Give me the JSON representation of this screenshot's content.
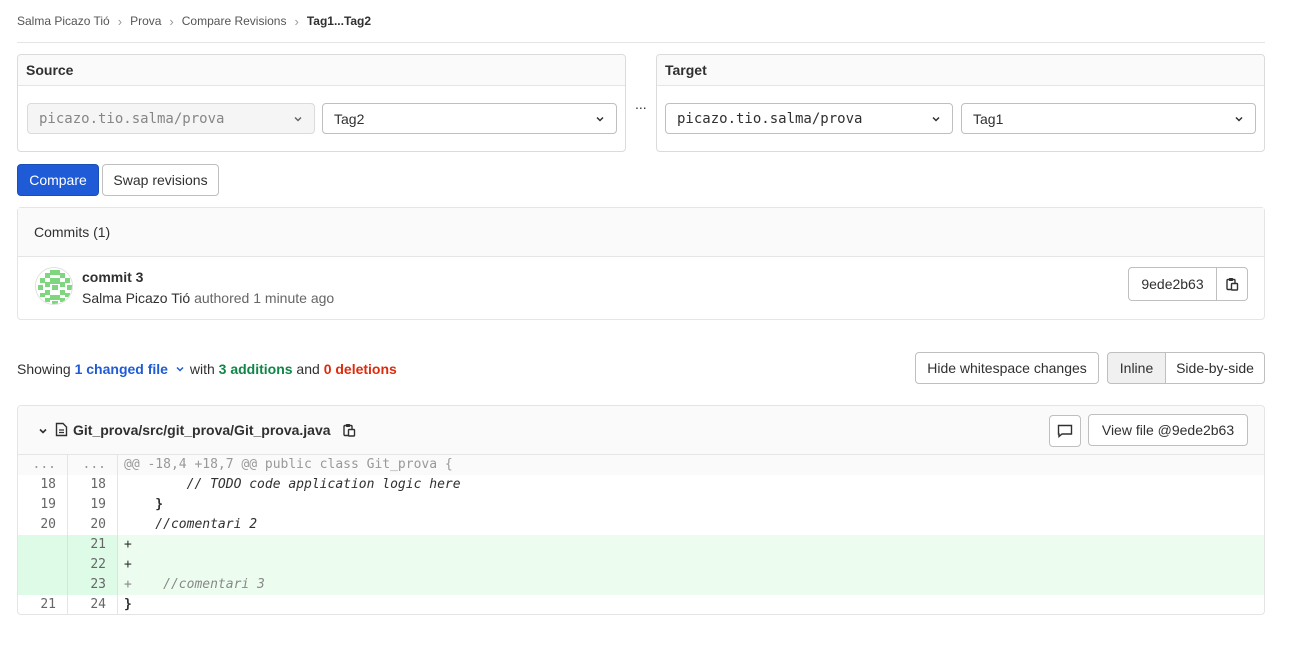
{
  "breadcrumbs": [
    "Salma Picazo Tió",
    "Prova",
    "Compare Revisions",
    "Tag1...Tag2"
  ],
  "source": {
    "title": "Source",
    "project": "picazo.tio.salma/prova",
    "revision": "Tag2"
  },
  "separator": "...",
  "target": {
    "title": "Target",
    "project": "picazo.tio.salma/prova",
    "revision": "Tag1"
  },
  "actions": {
    "compare": "Compare",
    "swap": "Swap revisions"
  },
  "commits": {
    "header": "Commits (1)",
    "items": [
      {
        "title": "commit 3",
        "author": "Salma Picazo Tió",
        "verb": "authored",
        "time": "1 minute ago",
        "sha": "9ede2b63"
      }
    ]
  },
  "stats": {
    "showing": "Showing ",
    "changed": "1 changed file",
    "with": " with ",
    "additions": "3 additions",
    "and": " and ",
    "deletions": "0 deletions"
  },
  "view_options": {
    "whitespace": "Hide whitespace changes",
    "inline": "Inline",
    "side_by_side": "Side-by-side"
  },
  "file": {
    "path": "Git_prova/src/git_prova/Git_prova.java",
    "view_file": "View file @9ede2b63",
    "lines": [
      {
        "type": "match",
        "old": "...",
        "new": "...",
        "text": "@@ -18,4 +18,7 @@ public class Git_prova {"
      },
      {
        "type": "context",
        "old": "18",
        "new": "18",
        "text": "        // TODO code application logic here"
      },
      {
        "type": "context",
        "old": "19",
        "new": "19",
        "text": "    }"
      },
      {
        "type": "context",
        "old": "20",
        "new": "20",
        "text": "    //comentari 2"
      },
      {
        "type": "add",
        "old": "",
        "new": "21",
        "text": "+"
      },
      {
        "type": "add",
        "old": "",
        "new": "22",
        "text": "+"
      },
      {
        "type": "add",
        "old": "",
        "new": "23",
        "text": "+    //comentari 3"
      },
      {
        "type": "context",
        "old": "21",
        "new": "24",
        "text": "}"
      }
    ]
  },
  "colors": {
    "primary": "#1f5bd6",
    "additions": "#108548",
    "deletions": "#dd2b0e",
    "added_line_bg": "#ecfdf0"
  }
}
